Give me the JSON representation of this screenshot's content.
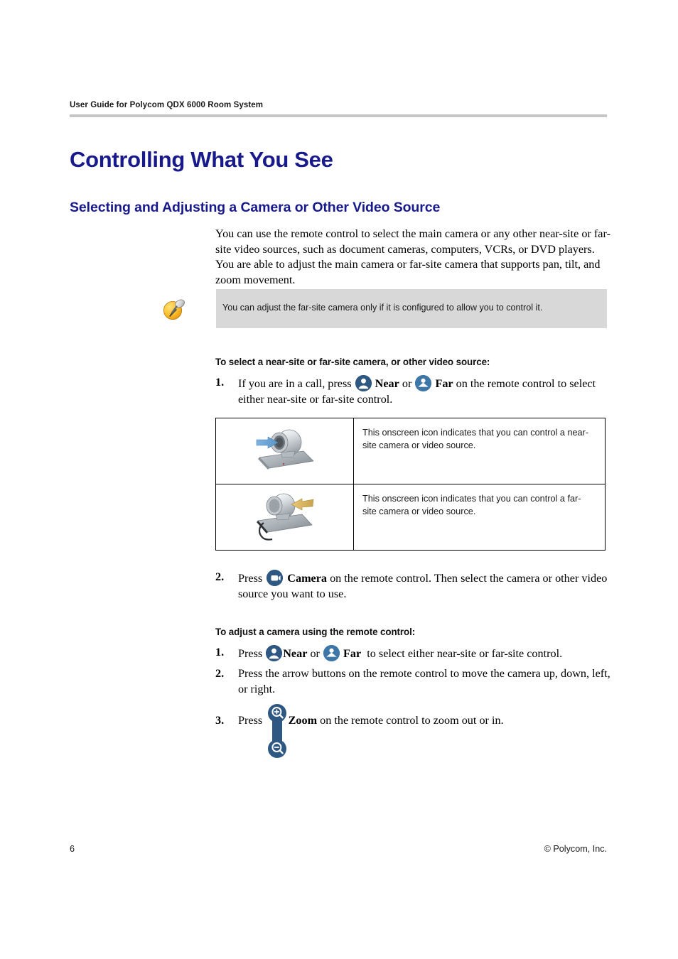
{
  "header": {
    "running_header": "User Guide for Polycom QDX 6000 Room System"
  },
  "titles": {
    "chapter": "Controlling What You See",
    "section": "Selecting and Adjusting a Camera or Other Video Source"
  },
  "intro": "You can use the remote control to select the main camera or any other near-site or far-site video sources, such as document cameras, computers, VCRs, or DVD players. You are able to adjust the main camera or far-site camera that supports pan, tilt, and zoom movement.",
  "note": {
    "icon": "note-pin-icon",
    "text": "You can adjust the far-site camera only if it is configured to allow you to control it."
  },
  "procedure_1": {
    "heading": "To select a near-site or far-site camera, or other video source:",
    "steps": [
      {
        "number": "1.",
        "before": "If you are in a call, press",
        "icon_1": "near-button-icon",
        "label_1": "Near",
        "middle": "or",
        "icon_2": "far-button-icon",
        "label_2": "Far",
        "after": "on the remote control to select either near-site or far-site control."
      },
      {
        "number": "2.",
        "before": "Press",
        "icon_1": "camera-button-icon",
        "label_1": "Camera",
        "after": "on the remote control. Then select the camera or other video source you want to use."
      }
    ]
  },
  "icon_table": {
    "rows": [
      {
        "icon": "near-site-camera-graphic",
        "description": "This onscreen icon indicates that you can control a near-site camera or video source."
      },
      {
        "icon": "far-site-camera-graphic",
        "description": "This onscreen icon indicates that you can control a far-site camera or video source."
      }
    ]
  },
  "procedure_2": {
    "heading": "To adjust a camera using the remote control:",
    "steps": [
      {
        "number": "1.",
        "before": "Press",
        "icon_1": "near-button-icon",
        "label_1": "Near",
        "middle": "or",
        "icon_2": "far-button-icon",
        "label_2": "Far",
        "after": "to select either near-site or far-site control."
      },
      {
        "number": "2.",
        "text": "Press the arrow buttons on the remote control to move the camera up, down, left, or right."
      },
      {
        "number": "3.",
        "before": "Press",
        "icon_1": "zoom-rocker-icon",
        "label_1": "Zoom",
        "after": "on the remote control to zoom out or in."
      }
    ]
  },
  "footer": {
    "page_number": "6",
    "copyright": "© Polycom, Inc."
  },
  "colors": {
    "heading_blue": "#181a8c",
    "near_button": "#2e5781",
    "far_button": "#3d77a8",
    "note_background": "#d8d8d8",
    "rule_gray": "#c6c6c6"
  }
}
